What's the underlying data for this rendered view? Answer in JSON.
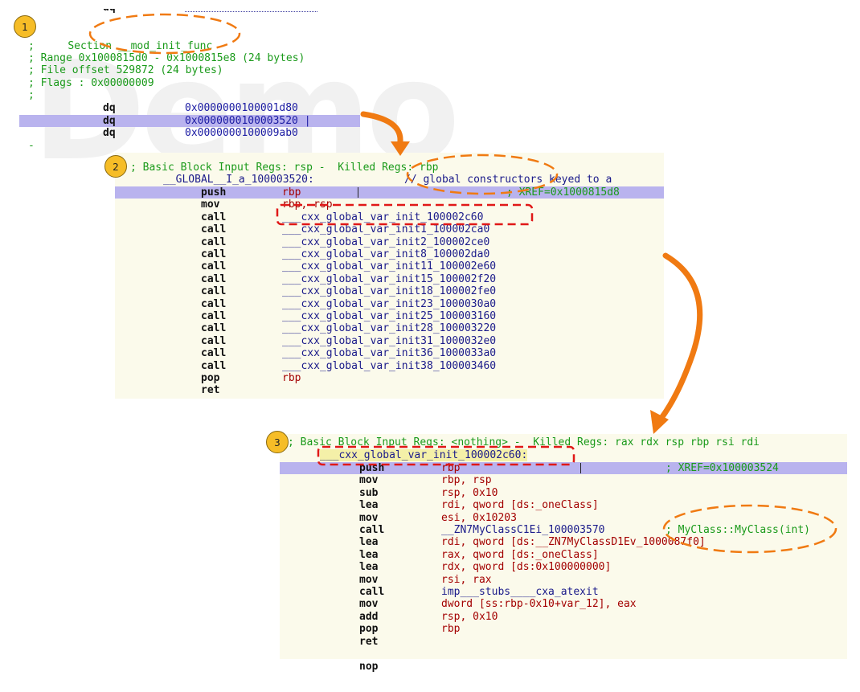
{
  "watermark": "Demo",
  "badges": [
    "1",
    "2",
    "3"
  ],
  "section1": {
    "top_frag": "dq",
    "section_prefix": "Section",
    "section_name": "__mod_init_func",
    "semicolon": ";",
    "range": "; Range 0x1000815d0 - 0x1000815e8 (24 bytes)",
    "file_offset": "; File offset 529872 (24 bytes)",
    "flags": "; Flags : 0x00000009",
    "rows": [
      {
        "mn": "dq",
        "val": "0x0000000100001d80"
      },
      {
        "mn": "dq",
        "val": "0x0000000100003520 |"
      },
      {
        "mn": "dq",
        "val": "0x0000000100009ab0"
      }
    ],
    "dash": "-"
  },
  "block2": {
    "header": "; Basic Block Input Regs: rsp -  Killed Regs: rbp",
    "label": "__GLOBAL__I_a_100003520:",
    "label_comment": "// global constructors keyed to a",
    "xref": "; XREF=0x1000815d8",
    "rows": [
      {
        "mn": "push",
        "op": "rbp"
      },
      {
        "mn": "mov",
        "op": "rbp, rsp"
      },
      {
        "mn": "call",
        "op": "___cxx_global_var_init_100002c60"
      },
      {
        "mn": "call",
        "op": "___cxx_global_var_init1_100002ca0"
      },
      {
        "mn": "call",
        "op": "___cxx_global_var_init2_100002ce0"
      },
      {
        "mn": "call",
        "op": "___cxx_global_var_init8_100002da0"
      },
      {
        "mn": "call",
        "op": "___cxx_global_var_init11_100002e60"
      },
      {
        "mn": "call",
        "op": "___cxx_global_var_init15_100002f20"
      },
      {
        "mn": "call",
        "op": "___cxx_global_var_init18_100002fe0"
      },
      {
        "mn": "call",
        "op": "___cxx_global_var_init23_1000030a0"
      },
      {
        "mn": "call",
        "op": "___cxx_global_var_init25_100003160"
      },
      {
        "mn": "call",
        "op": "___cxx_global_var_init28_100003220"
      },
      {
        "mn": "call",
        "op": "___cxx_global_var_init31_1000032e0"
      },
      {
        "mn": "call",
        "op": "___cxx_global_var_init36_1000033a0"
      },
      {
        "mn": "call",
        "op": "___cxx_global_var_init38_100003460"
      },
      {
        "mn": "pop",
        "op": "rbp"
      },
      {
        "mn": "ret",
        "op": ""
      }
    ]
  },
  "block3": {
    "header": "; Basic Block Input Regs: <nothing> -  Killed Regs: rax rdx rsp rbp rsi rdi",
    "label": "___cxx_global_var_init_100002c60:",
    "xref": "; XREF=0x100003524",
    "annotation": "; MyClass::MyClass(int)",
    "rows": [
      {
        "mn": "push",
        "op": "rbp"
      },
      {
        "mn": "mov",
        "op": "rbp, rsp"
      },
      {
        "mn": "sub",
        "op": "rsp, 0x10"
      },
      {
        "mn": "lea",
        "op": "rdi, qword [ds:_oneClass]"
      },
      {
        "mn": "mov",
        "op": "esi, 0x10203"
      },
      {
        "mn": "call",
        "op": "__ZN7MyClassC1Ei_100003570"
      },
      {
        "mn": "lea",
        "op": "rdi, qword [ds:__ZN7MyClassD1Ev_1000087f0]"
      },
      {
        "mn": "lea",
        "op": "rax, qword [ds:_oneClass]"
      },
      {
        "mn": "lea",
        "op": "rdx, qword [ds:0x100000000]"
      },
      {
        "mn": "mov",
        "op": "rsi, rax"
      },
      {
        "mn": "call",
        "op": "imp___stubs____cxa_atexit"
      },
      {
        "mn": "mov",
        "op": "dword [ss:rbp-0x10+var_12], eax"
      },
      {
        "mn": "add",
        "op": "rsp, 0x10"
      },
      {
        "mn": "pop",
        "op": "rbp"
      },
      {
        "mn": "ret",
        "op": ""
      }
    ],
    "trailing": "nop"
  }
}
